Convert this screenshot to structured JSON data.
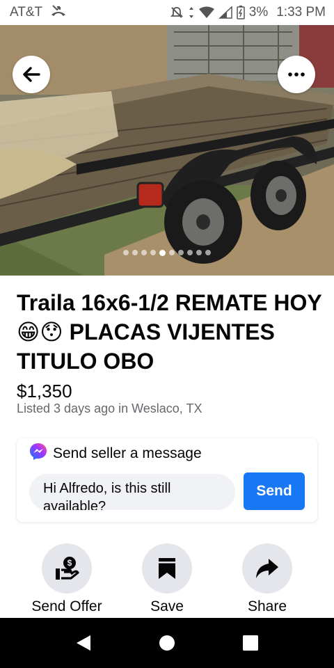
{
  "status_bar": {
    "carrier": "AT&T",
    "battery_percent": "3%",
    "time": "1:33 PM"
  },
  "photo": {
    "slide_count": 10,
    "active_slide": 4
  },
  "listing": {
    "title": "Traila 16x6-1/2 REMATE HOY 😁😯 PLACAS VIJENTES TITULO OBO",
    "price": "$1,350",
    "meta": "Listed 3 days ago in Weslaco, TX"
  },
  "message": {
    "header": "Send seller a message",
    "input_value": "Hi Alfredo, is this still available?",
    "send_label": "Send"
  },
  "actions": [
    {
      "label": "Send Offer",
      "icon": "send-offer-icon"
    },
    {
      "label": "Save",
      "icon": "bookmark-icon"
    },
    {
      "label": "Share",
      "icon": "share-icon"
    }
  ],
  "colors": {
    "accent": "#1877f2",
    "secondary_text": "#65676b",
    "action_bg": "#e4e6eb"
  }
}
